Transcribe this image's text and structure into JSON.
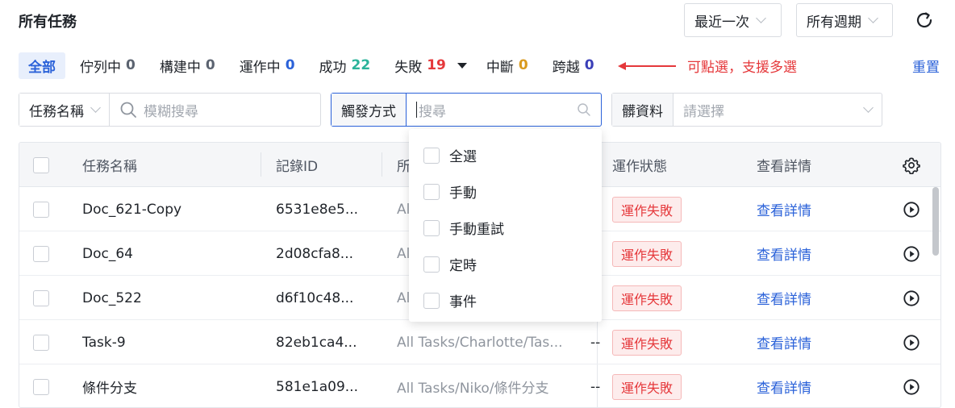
{
  "header": {
    "title": "所有任務",
    "recent_select": "最近一次",
    "period_select": "所有週期",
    "refresh_icon": "refresh-icon"
  },
  "tabs": [
    {
      "label": "全部",
      "count": "",
      "active": true
    },
    {
      "label": "佇列中",
      "count": "0",
      "color": "#5b6370"
    },
    {
      "label": "構建中",
      "count": "0",
      "color": "#5b6370"
    },
    {
      "label": "運作中",
      "count": "0",
      "color": "#2b62d9"
    },
    {
      "label": "成功",
      "count": "22",
      "color": "#2bb39a"
    },
    {
      "label": "失敗",
      "count": "19",
      "color": "#e5383b"
    },
    {
      "label": "中斷",
      "count": "0",
      "color": "#d99a1e"
    },
    {
      "label": "跨越",
      "count": "0",
      "color": "#3a3fb8"
    }
  ],
  "annotation": "可點選，支援多選",
  "reset_label": "重置",
  "filters": {
    "task_name_select": "任務名稱",
    "fuzzy_placeholder": "模糊搜尋",
    "trigger_label": "觸發方式",
    "trigger_placeholder": "搜尋",
    "resource_label": "髒資料",
    "resource_placeholder": "請選擇"
  },
  "trigger_options": [
    "全選",
    "手動",
    "手動重試",
    "定時",
    "事件"
  ],
  "table": {
    "headers": {
      "name": "任務名稱",
      "record_id": "記錄ID",
      "path": "所",
      "status": "運作狀態",
      "details": "查看詳情"
    },
    "rows": [
      {
        "name": "Doc_621-Copy",
        "record_id": "6531e8e5...",
        "path": "All",
        "extra": "",
        "status": "運作失敗",
        "details": "查看詳情"
      },
      {
        "name": "Doc_64",
        "record_id": "2d08cfa8...",
        "path": "All",
        "extra": "",
        "status": "運作失敗",
        "details": "查看詳情"
      },
      {
        "name": "Doc_522",
        "record_id": "d6f10c48...",
        "path": "All",
        "extra": "",
        "status": "運作失敗",
        "details": "查看詳情"
      },
      {
        "name": "Task-9",
        "record_id": "82eb1ca4...",
        "path": "All Tasks/Charlotte/Tas...",
        "extra": "--",
        "status": "運作失敗",
        "details": "查看詳情"
      },
      {
        "name": "條件分支",
        "record_id": "581e1a09...",
        "path": "All Tasks/Niko/條件分支",
        "extra": "--",
        "status": "運作失敗",
        "details": "查看詳情"
      }
    ]
  },
  "colors": {
    "accent": "#2b62d9",
    "danger": "#e5383b"
  }
}
